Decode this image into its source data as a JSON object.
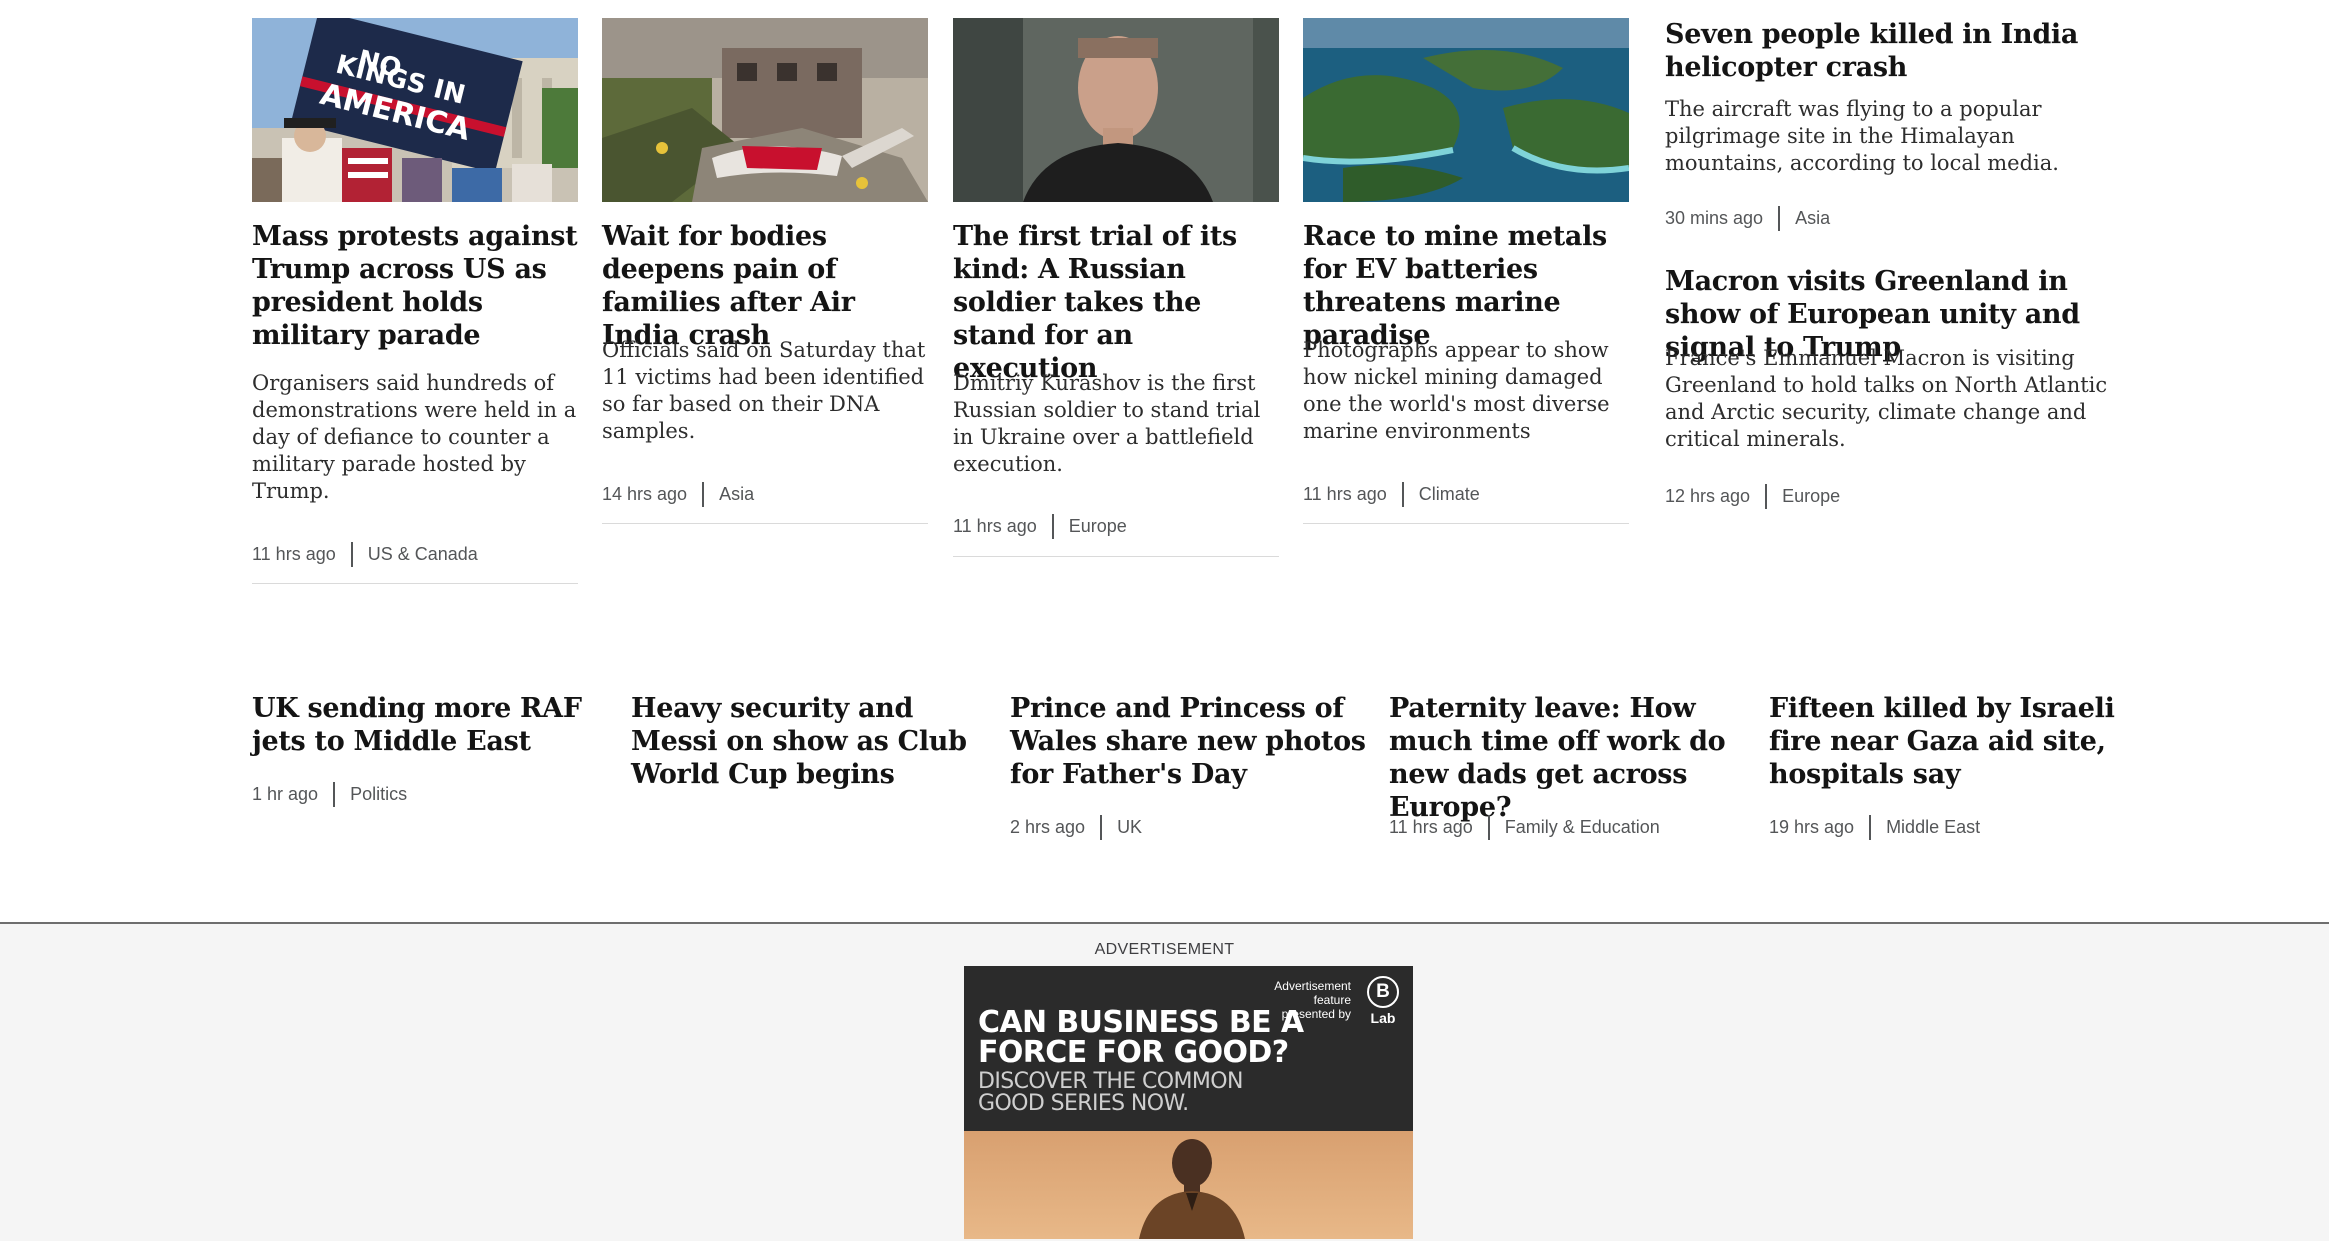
{
  "top_stories": [
    {
      "headline": "Mass protests against Trump across US as president holds military parade",
      "summary": "Organisers said hundreds of demonstrations were held in a day of defiance to counter a military parade hosted by Trump.",
      "time": "11 hrs ago",
      "category": "US & Canada",
      "image_text": "NO KINGS IN AMERICA"
    },
    {
      "headline": "Wait for bodies deepens pain of families after Air India crash",
      "summary": "Officials said on Saturday that 11 victims had been identified so far based on their DNA samples.",
      "time": "14 hrs ago",
      "category": "Asia"
    },
    {
      "headline": "The first trial of its kind: A Russian soldier takes the stand for an execution",
      "summary": "Dmitriy Kurashov is the first Russian soldier to stand trial in Ukraine over a battlefield execution.",
      "time": "11 hrs ago",
      "category": "Europe"
    },
    {
      "headline": "Race to mine metals for EV batteries threatens marine paradise",
      "summary": "Photographs appear to show how nickel mining damaged one the world's most diverse marine environments",
      "time": "11 hrs ago",
      "category": "Climate"
    }
  ],
  "side_stories": [
    {
      "headline": "Seven people killed in India helicopter crash",
      "summary": "The aircraft was flying to a popular pilgrimage site in the Himalayan mountains, according to local media.",
      "time": "30 mins ago",
      "category": "Asia"
    },
    {
      "headline": "Macron visits Greenland in show of European unity and signal to Trump",
      "summary": "France's Emmanuel Macron is visiting Greenland to hold talks on North Atlantic and Arctic security, climate change and critical minerals.",
      "time": "12 hrs ago",
      "category": "Europe"
    }
  ],
  "more_stories": [
    {
      "headline": "UK sending more RAF jets to Middle East",
      "time": "1 hr ago",
      "category": "Politics"
    },
    {
      "headline": "Heavy security and Messi on show as Club World Cup begins",
      "time": "",
      "category": ""
    },
    {
      "headline": "Prince and Princess of Wales share new photos for Father's Day",
      "time": "2 hrs ago",
      "category": "UK"
    },
    {
      "headline": "Paternity leave: How much time off work do new dads get across Europe?",
      "time": "11 hrs ago",
      "category": "Family & Education"
    },
    {
      "headline": "Fifteen killed by Israeli fire near Gaza aid site, hospitals say",
      "time": "19 hrs ago",
      "category": "Middle East"
    }
  ],
  "advertisement": {
    "label": "ADVERTISEMENT",
    "feature_text": "Advertisement feature presented by",
    "logo_letter": "B",
    "logo_text": "Lab",
    "headline_line1": "CAN BUSINESS BE A",
    "headline_line2": "FORCE FOR GOOD?",
    "sub_line1": "DISCOVER THE COMMON",
    "sub_line2": "GOOD SERIES NOW."
  },
  "colors": {
    "text": "#141414",
    "meta": "#545658",
    "ad_background": "#2b2b2b",
    "band": "#f5f5f5"
  }
}
